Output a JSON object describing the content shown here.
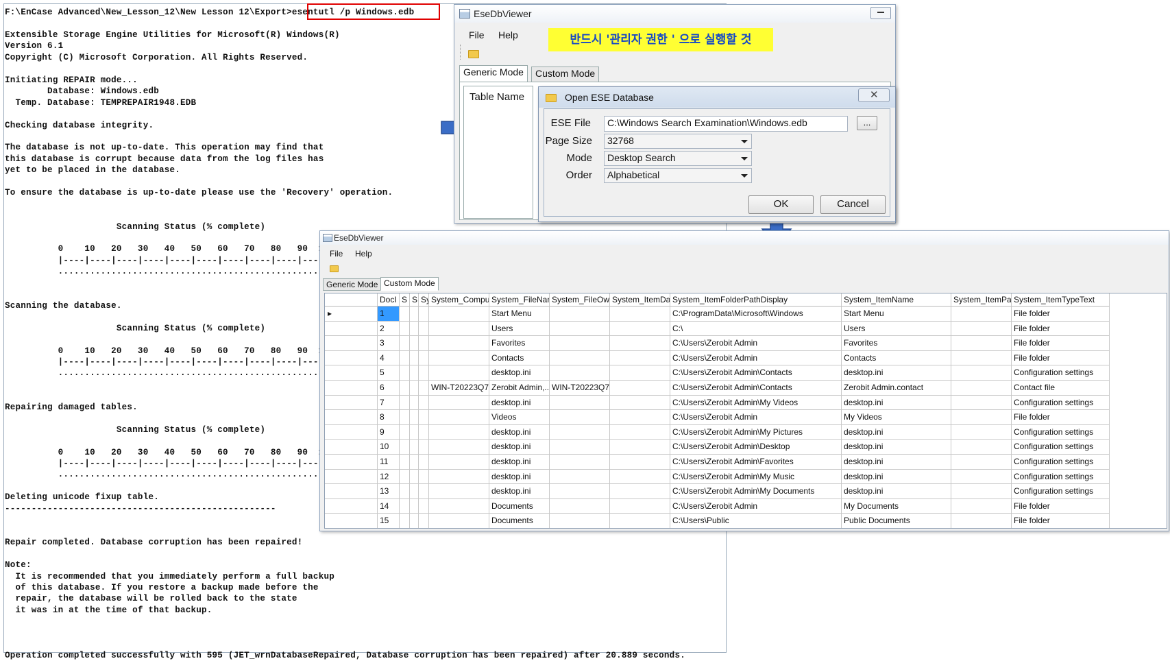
{
  "console": {
    "lines": [
      "F:\\EnCase Advanced\\New_Lesson_12\\New Lesson 12\\Export>esentutl /p Windows.edb",
      "",
      "Extensible Storage Engine Utilities for Microsoft(R) Windows(R)",
      "Version 6.1",
      "Copyright (C) Microsoft Corporation. All Rights Reserved.",
      "",
      "Initiating REPAIR mode...",
      "        Database: Windows.edb",
      "  Temp. Database: TEMPREPAIR1948.EDB",
      "",
      "Checking database integrity.",
      "",
      "The database is not up-to-date. This operation may find that",
      "this database is corrupt because data from the log files has",
      "yet to be placed in the database.",
      "",
      "To ensure the database is up-to-date please use the 'Recovery' operation.",
      "",
      "",
      "                     Scanning Status (% complete)",
      "",
      "          0    10   20   30   40   50   60   70   80   90  100",
      "          |----|----|----|----|----|----|----|----|----|----|",
      "          ...................................................",
      "",
      "",
      "Scanning the database.",
      "",
      "                     Scanning Status (% complete)",
      "",
      "          0    10   20   30   40   50   60   70   80   90  100",
      "          |----|----|----|----|----|----|----|----|----|----|",
      "          ...................................................",
      "",
      "",
      "Repairing damaged tables.",
      "",
      "                     Scanning Status (% complete)",
      "",
      "          0    10   20   30   40   50   60   70   80   90  100",
      "          |----|----|----|----|----|----|----|----|----|----|",
      "          ...................................................",
      "",
      "Deleting unicode fixup table.",
      "---------------------------------------------------",
      "",
      "",
      "Repair completed. Database corruption has been repaired!",
      "",
      "Note:",
      "  It is recommended that you immediately perform a full backup",
      "  of this database. If you restore a backup made before the",
      "  repair, the database will be rolled back to the state",
      "  it was in at the time of that backup.",
      "",
      "",
      "",
      "Operation completed successfully with 595 (JET_wrnDatabaseRepaired, Database corruption has been repaired) after 20.889 seconds."
    ]
  },
  "banner": "반드시 '관리자 권한 ' 으로 실행할 것",
  "win1": {
    "title": "EseDbViewer",
    "menu": [
      "File",
      "Help"
    ],
    "tabs": [
      "Generic Mode",
      "Custom Mode"
    ],
    "table_name_label": "Table Name"
  },
  "dialog": {
    "title": "Open ESE Database",
    "ese_file_label": "ESE File",
    "ese_file_value": "C:\\Windows Search Examination\\Windows.edb",
    "browse_label": "...",
    "page_size_label": "Page Size",
    "page_size_value": "32768",
    "mode_label": "Mode",
    "mode_value": "Desktop Search",
    "order_label": "Order",
    "order_value": "Alphabetical",
    "ok_label": "OK",
    "cancel_label": "Cancel"
  },
  "win2": {
    "title": "EseDbViewer",
    "menu": [
      "File",
      "Help"
    ],
    "tabs": [
      "Generic Mode",
      "Custom Mode"
    ],
    "columns": [
      "DocI",
      "S",
      "S",
      "Sy",
      "System_Comput",
      "System_FileNan",
      "System_FileOwr",
      "System_ItemDat",
      "System_ItemFolderPathDisplay",
      "System_ItemName",
      "System_ItemPat",
      "System_ItemTypeText"
    ],
    "rows": [
      [
        "1",
        "",
        "",
        "",
        "",
        "Start Menu",
        "",
        "",
        "C:\\ProgramData\\Microsoft\\Windows",
        "Start Menu",
        "",
        "File folder"
      ],
      [
        "2",
        "",
        "",
        "",
        "",
        "Users",
        "",
        "",
        "C:\\",
        "Users",
        "",
        "File folder"
      ],
      [
        "3",
        "",
        "",
        "",
        "",
        "Favorites",
        "",
        "",
        "C:\\Users\\Zerobit Admin",
        "Favorites",
        "",
        "File folder"
      ],
      [
        "4",
        "",
        "",
        "",
        "",
        "Contacts",
        "",
        "",
        "C:\\Users\\Zerobit Admin",
        "Contacts",
        "",
        "File folder"
      ],
      [
        "5",
        "",
        "",
        "",
        "",
        "desktop.ini",
        "",
        "",
        "C:\\Users\\Zerobit Admin\\Contacts",
        "desktop.ini",
        "",
        "Configuration settings"
      ],
      [
        "6",
        "",
        "",
        "",
        "WIN-T20223Q7,..",
        "Zerobit Admin,..",
        "WIN-T20223Q7,..",
        "",
        "C:\\Users\\Zerobit Admin\\Contacts",
        "Zerobit Admin.contact",
        "",
        "Contact file"
      ],
      [
        "7",
        "",
        "",
        "",
        "",
        "desktop.ini",
        "",
        "",
        "C:\\Users\\Zerobit Admin\\My Videos",
        "desktop.ini",
        "",
        "Configuration settings"
      ],
      [
        "8",
        "",
        "",
        "",
        "",
        "Videos",
        "",
        "",
        "C:\\Users\\Zerobit Admin",
        "My Videos",
        "",
        "File folder"
      ],
      [
        "9",
        "",
        "",
        "",
        "",
        "desktop.ini",
        "",
        "",
        "C:\\Users\\Zerobit Admin\\My Pictures",
        "desktop.ini",
        "",
        "Configuration settings"
      ],
      [
        "10",
        "",
        "",
        "",
        "",
        "desktop.ini",
        "",
        "",
        "C:\\Users\\Zerobit Admin\\Desktop",
        "desktop.ini",
        "",
        "Configuration settings"
      ],
      [
        "11",
        "",
        "",
        "",
        "",
        "desktop.ini",
        "",
        "",
        "C:\\Users\\Zerobit Admin\\Favorites",
        "desktop.ini",
        "",
        "Configuration settings"
      ],
      [
        "12",
        "",
        "",
        "",
        "",
        "desktop.ini",
        "",
        "",
        "C:\\Users\\Zerobit Admin\\My Music",
        "desktop.ini",
        "",
        "Configuration settings"
      ],
      [
        "13",
        "",
        "",
        "",
        "",
        "desktop.ini",
        "",
        "",
        "C:\\Users\\Zerobit Admin\\My Documents",
        "desktop.ini",
        "",
        "Configuration settings"
      ],
      [
        "14",
        "",
        "",
        "",
        "",
        "Documents",
        "",
        "",
        "C:\\Users\\Zerobit Admin",
        "My Documents",
        "",
        "File folder"
      ],
      [
        "15",
        "",
        "",
        "",
        "",
        "Documents",
        "",
        "",
        "C:\\Users\\Public",
        "Public Documents",
        "",
        "File folder"
      ]
    ]
  },
  "colors": {
    "highlight_box": "#e00000",
    "banner_bg": "#ffff33",
    "banner_text": "#1447c8",
    "arrow": "#3b6dc6",
    "selected_cell": "#3399ff"
  }
}
